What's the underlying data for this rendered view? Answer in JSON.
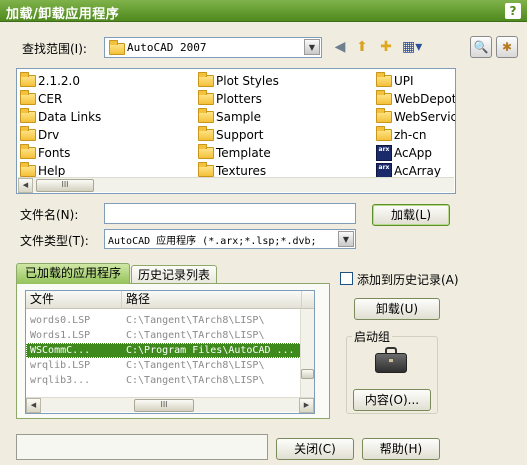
{
  "window": {
    "title": "加载/卸载应用程序",
    "help_glyph": "?"
  },
  "lookin": {
    "label": "查找范围(I):",
    "value": "AutoCAD 2007"
  },
  "toolbar": {
    "icons": [
      "back-icon",
      "up-folder-icon",
      "new-folder-icon",
      "views-icon",
      "search-web-icon",
      "favorites-icon"
    ]
  },
  "file_items": [
    {
      "name": "2.1.2.0",
      "icon": "folder"
    },
    {
      "name": "CER",
      "icon": "folder"
    },
    {
      "name": "Data Links",
      "icon": "folder"
    },
    {
      "name": "Drv",
      "icon": "folder"
    },
    {
      "name": "Fonts",
      "icon": "folder"
    },
    {
      "name": "Help",
      "icon": "folder"
    },
    {
      "name": "Plot Styles",
      "icon": "folder"
    },
    {
      "name": "Plotters",
      "icon": "folder"
    },
    {
      "name": "Sample",
      "icon": "folder"
    },
    {
      "name": "Support",
      "icon": "folder"
    },
    {
      "name": "Template",
      "icon": "folder"
    },
    {
      "name": "Textures",
      "icon": "folder"
    },
    {
      "name": "UPI",
      "icon": "folder"
    },
    {
      "name": "WebDepot",
      "icon": "folder"
    },
    {
      "name": "WebServic",
      "icon": "folder"
    },
    {
      "name": "zh-cn",
      "icon": "folder"
    },
    {
      "name": "AcApp",
      "icon": "arx"
    },
    {
      "name": "AcArray",
      "icon": "arx"
    }
  ],
  "filelist_scroll": {
    "thumb": "III"
  },
  "filename": {
    "label": "文件名(N):",
    "value": ""
  },
  "filetype": {
    "label": "文件类型(T):",
    "value": "AutoCAD 应用程序 (*.arx;*.lsp;*.dvb;"
  },
  "buttons": {
    "load": "加载(L)",
    "unload": "卸载(U)",
    "contents": "内容(O)...",
    "close": "关闭(C)",
    "help": "帮助(H)"
  },
  "tabs": [
    {
      "label": "已加载的应用程序",
      "active": true
    },
    {
      "label": "历史记录列表",
      "active": false
    }
  ],
  "add_history": {
    "label": "添加到历史记录(A)",
    "checked": false
  },
  "loaded_table": {
    "columns": [
      "文件",
      "路径"
    ],
    "rows": [
      {
        "file": "words0.LSP",
        "path": "C:\\Tangent\\TArch8\\LISP\\",
        "selected": false
      },
      {
        "file": "Words1.LSP",
        "path": "C:\\Tangent\\TArch8\\LISP\\",
        "selected": false
      },
      {
        "file": "WSCommC...",
        "path": "C:\\Program Files\\AutoCAD ...",
        "selected": true
      },
      {
        "file": "wrqlib.LSP",
        "path": "C:\\Tangent\\TArch8\\LISP\\",
        "selected": false
      },
      {
        "file": "wrqlib3...",
        "path": "C:\\Tangent\\TArch8\\LISP\\",
        "selected": false
      }
    ],
    "hscroll_thumb": "III"
  },
  "startup": {
    "label": "启动组"
  },
  "status_text": ""
}
